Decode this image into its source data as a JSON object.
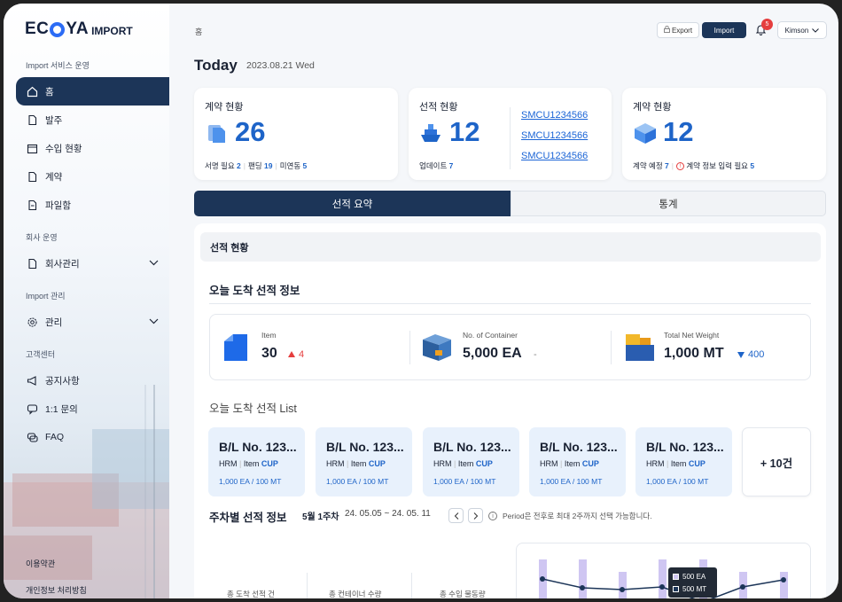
{
  "logo": {
    "brand_left": "EC",
    "brand_right": "YA",
    "suffix": "IMPORT"
  },
  "sidebar": {
    "section1": "Import 서비스 운영",
    "items1": [
      {
        "label": "홈",
        "icon": "home-icon"
      },
      {
        "label": "발주",
        "icon": "document-icon"
      },
      {
        "label": "수입 현황",
        "icon": "calendar-icon"
      },
      {
        "label": "계약",
        "icon": "contract-icon"
      },
      {
        "label": "파일함",
        "icon": "folder-icon"
      }
    ],
    "section2": "회사 운영",
    "company": "회사관리",
    "section3": "Import 관리",
    "manage": "관리",
    "section4": "고객센터",
    "items4": [
      {
        "label": "공지사항",
        "icon": "megaphone-icon"
      },
      {
        "label": "1:1 문의",
        "icon": "chat-icon"
      },
      {
        "label": "FAQ",
        "icon": "faq-icon"
      }
    ],
    "terms": "이용약관",
    "privacy": "개인정보 처리방침"
  },
  "header": {
    "breadcrumb": "홈",
    "export_label": "Export",
    "import_label": "Import",
    "notification_count": "5",
    "user": "Kimson"
  },
  "page": {
    "title": "Today",
    "date": "2023.08.21 Wed"
  },
  "cards": {
    "contract": {
      "title": "계약 현황",
      "value": "26",
      "sub": [
        {
          "label": "서명 필요",
          "value": "2"
        },
        {
          "label": "팬딩",
          "value": "19"
        },
        {
          "label": "미연동",
          "value": "5"
        }
      ]
    },
    "shipping": {
      "title": "선적 현황",
      "value": "12",
      "update_label": "업데이트",
      "update_value": "7",
      "links": [
        "SMCU1234566",
        "SMCU1234566",
        "SMCU1234566"
      ]
    },
    "contract2": {
      "title": "계약 현황",
      "value": "12",
      "planned_label": "계약 예정",
      "planned_value": "7",
      "required_label": "계약 정보 입력 필요",
      "required_value": "5"
    }
  },
  "tabs": {
    "summary": "선적 요약",
    "stats": "통계"
  },
  "panel": {
    "header": "선적 현황",
    "today_info": "오늘 도착 선적 정보",
    "stats": {
      "item_label": "Item",
      "item_value": "30",
      "item_change": "4",
      "container_label": "No. of Container",
      "container_value": "5,000 EA",
      "container_change": "-",
      "weight_label": "Total Net Weight",
      "weight_value": "1,000 MT",
      "weight_change": "400"
    },
    "list_title": "오늘 도착 선적 List",
    "bl_cards": [
      {
        "title": "B/L No. 123...",
        "hrm": "HRM",
        "item": "Item",
        "cup": "CUP",
        "qty": "1,000 EA / 100 MT"
      },
      {
        "title": "B/L No. 123...",
        "hrm": "HRM",
        "item": "Item",
        "cup": "CUP",
        "qty": "1,000 EA / 100 MT"
      },
      {
        "title": "B/L No. 123...",
        "hrm": "HRM",
        "item": "Item",
        "cup": "CUP",
        "qty": "1,000 EA / 100 MT"
      },
      {
        "title": "B/L No. 123...",
        "hrm": "HRM",
        "item": "Item",
        "cup": "CUP",
        "qty": "1,000 EA / 100 MT"
      },
      {
        "title": "B/L No. 123...",
        "hrm": "HRM",
        "item": "Item",
        "cup": "CUP",
        "qty": "1,000 EA / 100 MT"
      }
    ],
    "more": "+ 10건",
    "weekly_title": "주차별 선적 정보",
    "week": "5월 1주차",
    "range": "24. 05.05 ~ 24. 05. 11",
    "period_note": "Period은 전후로 최대 2주까지 선택 가능합니다.",
    "bottom_labels": [
      "총 도착 선적 건",
      "총 컨테이너 수량",
      "총 수입 물동량"
    ],
    "tooltip": {
      "ea": "500 EA",
      "mt": "500 MT"
    }
  },
  "colors": {
    "primary": "#1c3558",
    "accent": "#1e64c8",
    "bar": "#cfc6f2"
  }
}
